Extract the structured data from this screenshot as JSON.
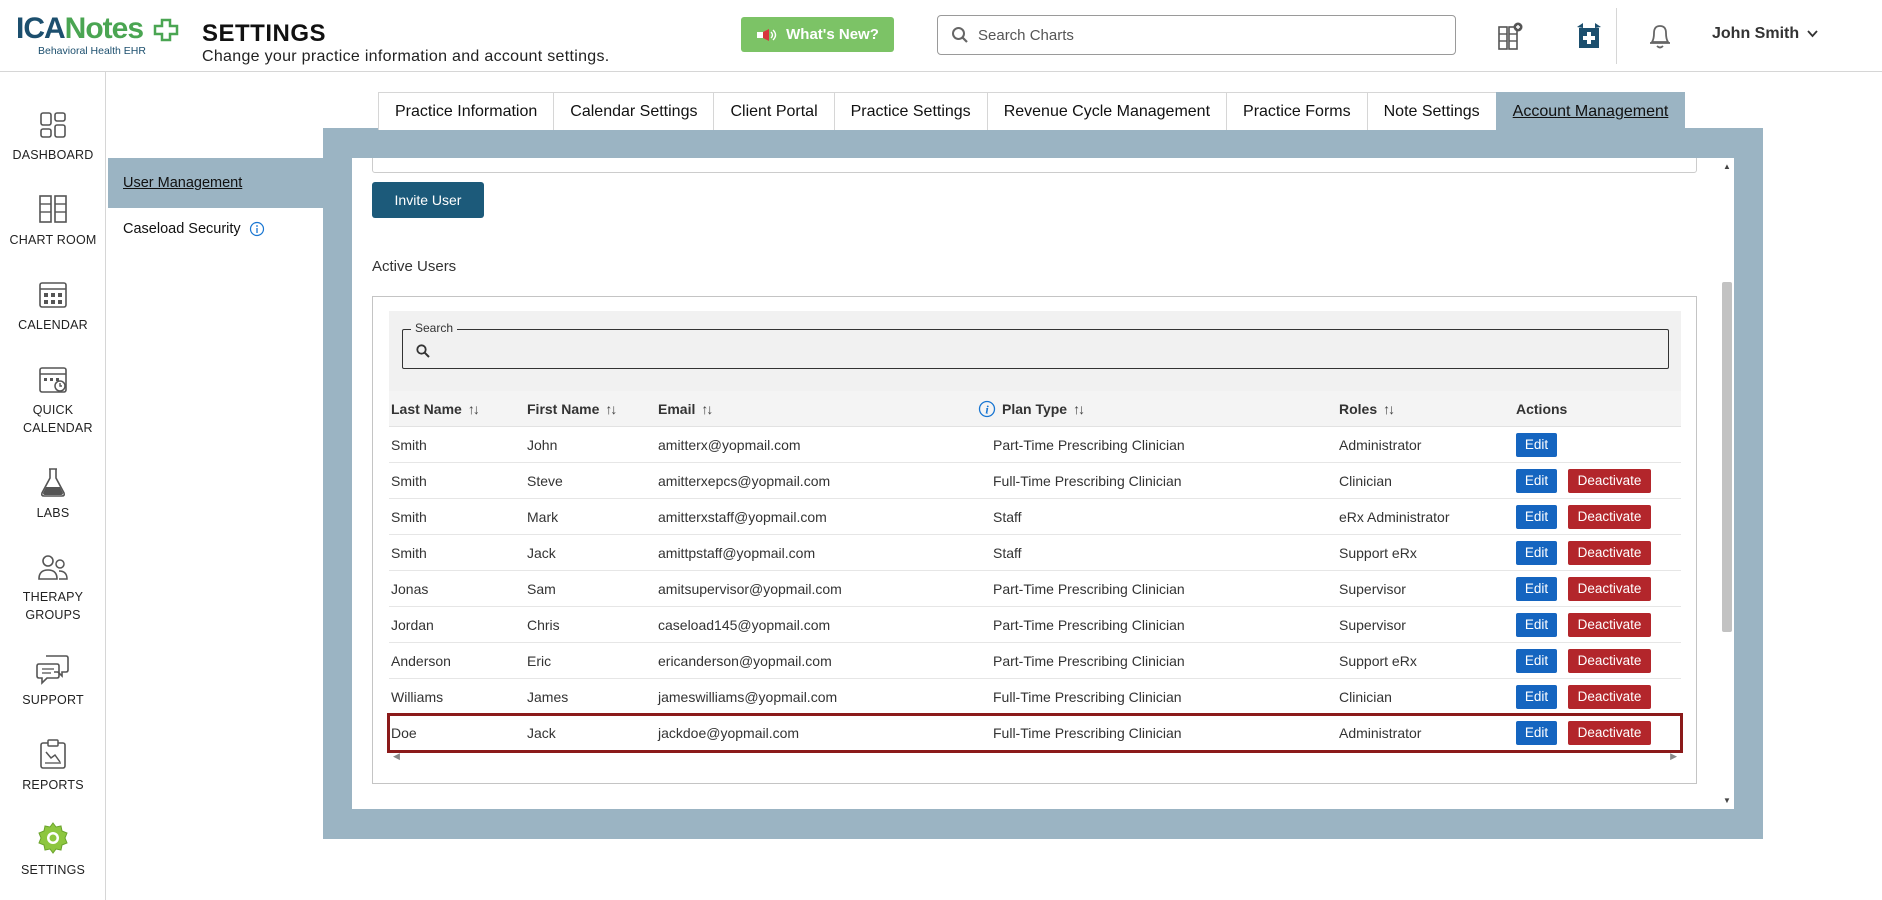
{
  "app": {
    "logo_text_ica": "ICA",
    "logo_text_notes": "Notes",
    "logo_sub": "Behavioral Health EHR",
    "page_title": "SETTINGS",
    "page_subtitle": "Change your practice information and account settings.",
    "whats_new": "What's New?",
    "search_placeholder": "Search Charts",
    "user_name": "John Smith"
  },
  "nav": [
    {
      "label": "DASHBOARD",
      "icon": "dashboard-icon"
    },
    {
      "label": "CHART ROOM",
      "icon": "chart-room-icon"
    },
    {
      "label": "CALENDAR",
      "icon": "calendar-icon"
    },
    {
      "label": "QUICK CALENDAR",
      "icon": "quick-calendar-icon"
    },
    {
      "label": "LABS",
      "icon": "labs-icon"
    },
    {
      "label": "THERAPY GROUPS",
      "icon": "therapy-groups-icon"
    },
    {
      "label": "SUPPORT",
      "icon": "support-icon"
    },
    {
      "label": "REPORTS",
      "icon": "reports-icon"
    },
    {
      "label": "SETTINGS",
      "icon": "settings-icon"
    }
  ],
  "tabs": [
    "Practice Information",
    "Calendar Settings",
    "Client Portal",
    "Practice Settings",
    "Revenue Cycle Management",
    "Practice Forms",
    "Note Settings",
    "Account Management"
  ],
  "active_tab": "Account Management",
  "subnav": {
    "active": "User Management",
    "item": "Caseload Security"
  },
  "content": {
    "invite_button": "Invite User",
    "section_title": "Active Users",
    "search_legend": "Search",
    "search_value": "",
    "columns": [
      "Last Name",
      "First Name",
      "Email",
      "Plan Type",
      "Roles",
      "Actions"
    ],
    "sort_glyph": "↑↓",
    "edit_label": "Edit",
    "deactivate_label": "Deactivate",
    "rows": [
      {
        "last": "Smith",
        "first": "John",
        "email": "amitterx@yopmail.com",
        "plan": "Part-Time Prescribing Clinician",
        "role": "Administrator",
        "deactivate": false
      },
      {
        "last": "Smith",
        "first": "Steve",
        "email": "amitterxepcs@yopmail.com",
        "plan": "Full-Time Prescribing Clinician",
        "role": "Clinician",
        "deactivate": true
      },
      {
        "last": "Smith",
        "first": "Mark",
        "email": "amitterxstaff@yopmail.com",
        "plan": "Staff",
        "role": "eRx Administrator",
        "deactivate": true
      },
      {
        "last": "Smith",
        "first": "Jack",
        "email": "amittpstaff@yopmail.com",
        "plan": "Staff",
        "role": "Support eRx",
        "deactivate": true
      },
      {
        "last": "Jonas",
        "first": "Sam",
        "email": "amitsupervisor@yopmail.com",
        "plan": "Part-Time Prescribing Clinician",
        "role": "Supervisor",
        "deactivate": true
      },
      {
        "last": "Jordan",
        "first": "Chris",
        "email": "caseload145@yopmail.com",
        "plan": "Part-Time Prescribing Clinician",
        "role": "Supervisor",
        "deactivate": true
      },
      {
        "last": "Anderson",
        "first": "Eric",
        "email": "ericanderson@yopmail.com",
        "plan": "Part-Time Prescribing Clinician",
        "role": "Support eRx",
        "deactivate": true
      },
      {
        "last": "Williams",
        "first": "James",
        "email": "jameswilliams@yopmail.com",
        "plan": "Full-Time Prescribing Clinician",
        "role": "Clinician",
        "deactivate": true
      },
      {
        "last": "Doe",
        "first": "Jack",
        "email": "jackdoe@yopmail.com",
        "plan": "Full-Time Prescribing Clinician",
        "role": "Administrator",
        "deactivate": true,
        "highlighted": true
      }
    ]
  },
  "colors": {
    "brand_dark": "#1c4f6e",
    "brand_green": "#4aa552",
    "panel_bg": "#9bb4c3",
    "edit_blue": "#1565c0",
    "deactivate_red": "#b3262b",
    "highlight_border": "#8b1a1a"
  }
}
